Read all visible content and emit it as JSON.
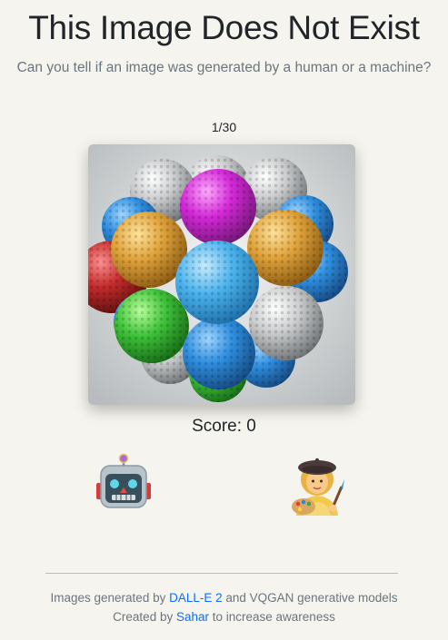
{
  "header": {
    "title": "This Image Does Not Exist",
    "subtitle": "Can you tell if an image was generated by a human or a machine?"
  },
  "game": {
    "counter": "1/30",
    "score_label": "Score: 0",
    "image_subject": "cluster of colorful golf balls",
    "choices": [
      {
        "icon": "robot-icon",
        "meaning": "machine"
      },
      {
        "icon": "artist-icon",
        "meaning": "human"
      }
    ]
  },
  "footer": {
    "line1_prefix": "Images generated by ",
    "line1_link": "DALL-E 2",
    "line1_suffix": " and VQGAN generative models",
    "line2_prefix": "Created by ",
    "line2_link": "Sahar",
    "line2_suffix": " to increase awareness"
  },
  "colors": {
    "background": "#f5f4ee",
    "link": "#0d6efd",
    "muted_text": "#6c757d"
  }
}
